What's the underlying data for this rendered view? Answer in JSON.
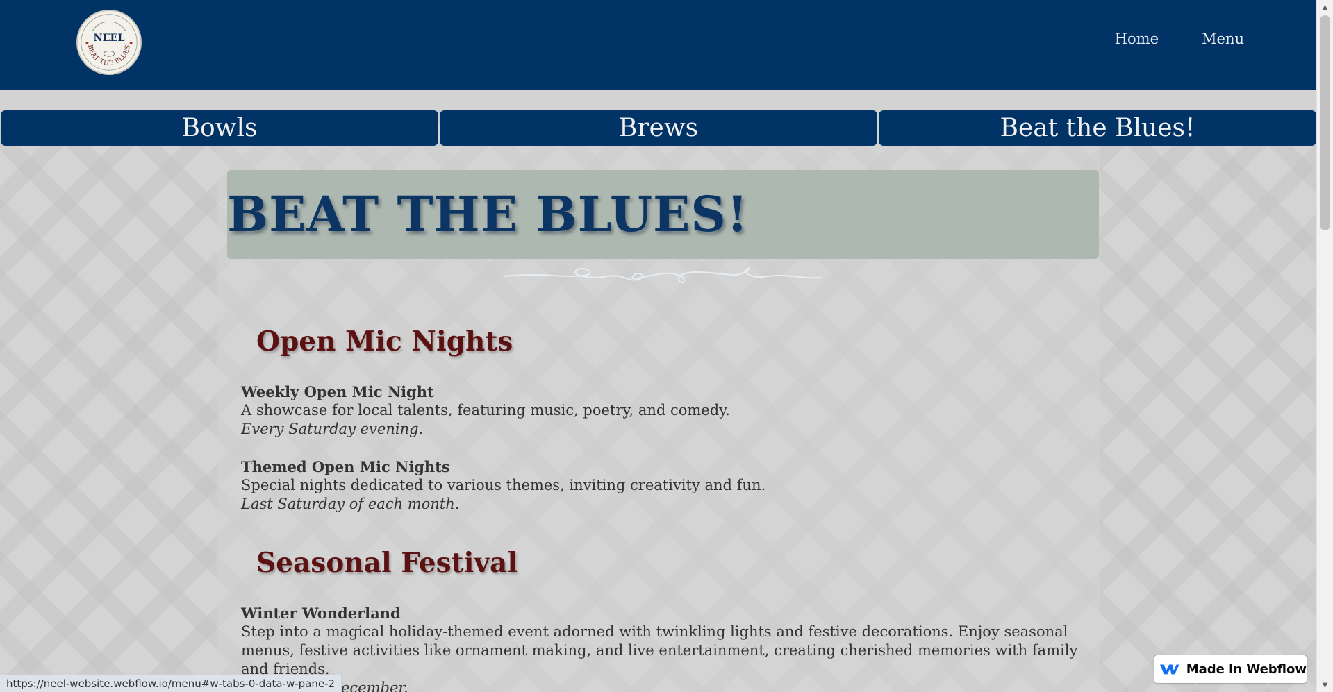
{
  "header": {
    "logo": {
      "top_text": "NEEL",
      "arc_text": "BEAT THE BLUES"
    },
    "nav": [
      "Home",
      "Menu"
    ]
  },
  "tabs": [
    "Bowls",
    "Brews",
    "Beat the Blues!"
  ],
  "hero": {
    "title": "BEAT THE BLUES!"
  },
  "sections": [
    {
      "title": "Open Mic Nights",
      "events": [
        {
          "title": "Weekly Open Mic Night",
          "description": "A showcase for local talents, featuring music, poetry, and comedy.",
          "when": "Every Saturday evening."
        },
        {
          "title": "Themed Open Mic Nights",
          "description": "Special nights dedicated to various themes, inviting creativity and fun.",
          "when": "Last Saturday of each month."
        }
      ]
    },
    {
      "title": "Seasonal Festival",
      "events": [
        {
          "title": "Winter Wonderland",
          "description": "Step into a magical holiday-themed event adorned with twinkling lights and festive decorations. Enjoy seasonal menus, festive activities like ornament making, and live entertainment, creating cherished memories with family and friends.",
          "when": "Annually in December."
        }
      ]
    }
  ],
  "status_bar": {
    "url": "https://neel-website.webflow.io/menu#w-tabs-0-data-w-pane-2"
  },
  "webflow_badge": {
    "label": "Made in Webflow"
  },
  "colors": {
    "header_bg": "#023366",
    "tab_bg": "#023366",
    "hero_bg": "#adb8b1",
    "hero_text": "#0d3563",
    "section_title": "#5c1212",
    "body_text": "#333333",
    "page_bg": "#d4d4d4"
  },
  "icons": {
    "scroll_up": "triangle-up-icon",
    "scroll_down": "triangle-down-icon",
    "webflow": "webflow-logo-icon"
  }
}
